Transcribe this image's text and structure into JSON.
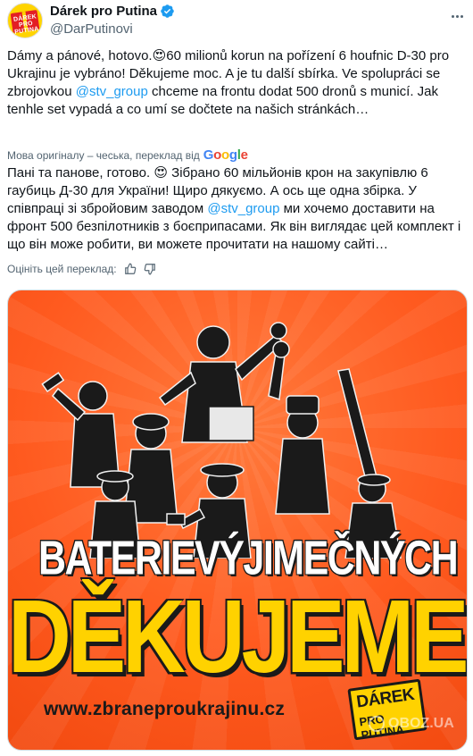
{
  "author": {
    "display_name": "Dárek pro Putina",
    "handle": "@DarPutinovi",
    "avatar_text": "DÁREK PRO PUTINA"
  },
  "tweet": {
    "text_before_mention": "Dámy a pánové, hotovo.😍60 milionů korun na pořízení 6 houfnic D-30 pro Ukrajinu je vybráno! Děkujeme moc. A je tu další sbírka. Ve spolupráci se zbrojovkou ",
    "mention": "@stv_group",
    "text_after_mention": " chceme na frontu dodat 500 dronů s municí. Jak tenhle set vypadá a co umí se dočtete na našich stránkách…"
  },
  "translation": {
    "note": "Мова оригіналу – чеська, переклад від",
    "provider": "Google",
    "text_before_mention": "Пані та панове, готово. 😍 Зібрано 60 мільйонів крон на закупівлю 6 гаубиць Д-30 для України! Щиро дякуємо. А ось ще одна збірка. У співпраці зі збройовим заводом ",
    "mention": "@stv_group",
    "text_after_mention": " ми хочемо доставити на фронт 500 безпілотників з боєприпасами. Як він виглядає цей комплект і що він може робити, ви можете прочитати на нашому сайті…",
    "rate_label": "Оцініть цей переклад:"
  },
  "media": {
    "headline_word1": "BATERIE",
    "headline_word2": "VÝJIMEČNÝCH",
    "headline_main": "DĚKUJEME!!!",
    "website": "www.zbraneproukrajinu.cz",
    "badge_line1": "DÁREK",
    "badge_line2": "PRO PUTINA",
    "watermark": "OBOZ.UA"
  },
  "colors": {
    "link": "#1d9bf0",
    "poster_orange": "#ff5a1f",
    "poster_yellow": "#ffd200",
    "verified": "#1d9bf0"
  },
  "icons": [
    "verified-badge-icon",
    "more-options-icon",
    "thumbs-up-icon",
    "thumbs-down-icon"
  ]
}
